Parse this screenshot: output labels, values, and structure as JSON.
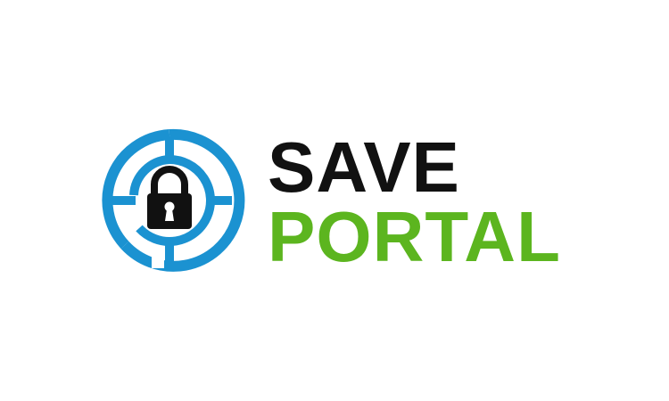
{
  "logo": {
    "line1": "SAVE",
    "line2": "PORTAL",
    "icon": "maze-lock-icon"
  },
  "colors": {
    "background": "#ffffff",
    "ring_blue": "#1b92d1",
    "text_dark": "#111111",
    "text_green": "#5cb51f",
    "lock_dark": "#111111"
  }
}
